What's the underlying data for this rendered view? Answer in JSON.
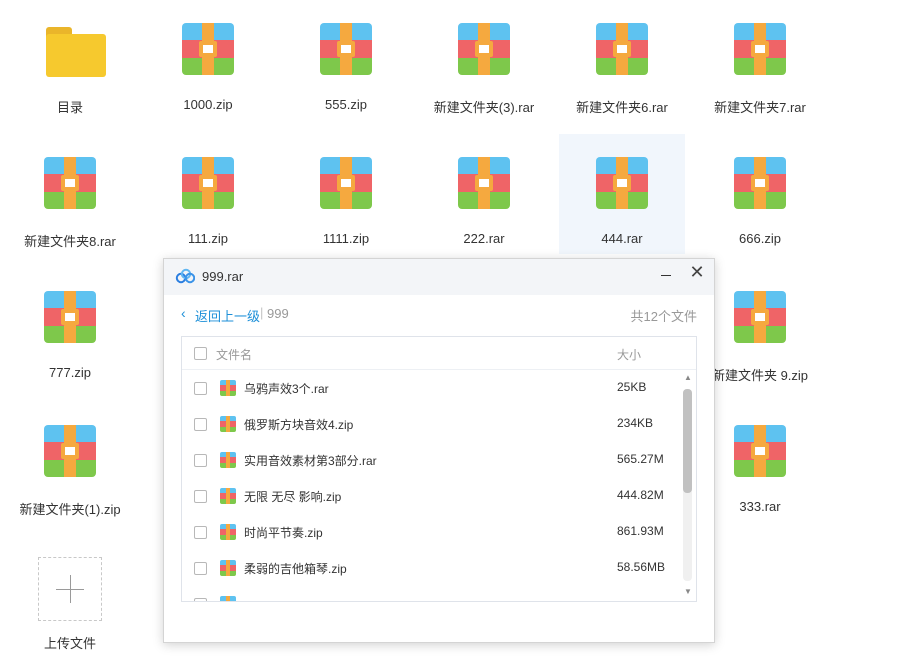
{
  "colors": {
    "archive_blue": "#5ec2f0",
    "archive_red": "#ef6467",
    "archive_green": "#7ec84b",
    "archive_strap": "#f5a93f",
    "folder_yellow": "#f6c92e",
    "folder_tab": "#eab52a",
    "link_blue": "#1c8fd8",
    "highlight": "#f1f6fc"
  },
  "grid": {
    "items": [
      {
        "label": "目录",
        "icon": "folder-icon",
        "kind": "folder"
      },
      {
        "label": "1000.zip",
        "icon": "archive-icon",
        "kind": "archive"
      },
      {
        "label": "555.zip",
        "icon": "archive-icon",
        "kind": "archive"
      },
      {
        "label": "新建文件夹(3).rar",
        "icon": "archive-icon",
        "kind": "archive"
      },
      {
        "label": "新建文件夹6.rar",
        "icon": "archive-icon",
        "kind": "archive"
      },
      {
        "label": "新建文件夹7.rar",
        "icon": "archive-icon",
        "kind": "archive"
      },
      {
        "label": "新建文件夹8.rar",
        "icon": "archive-icon",
        "kind": "archive"
      },
      {
        "label": "111.zip",
        "icon": "archive-icon",
        "kind": "archive"
      },
      {
        "label": "1111.zip",
        "icon": "archive-icon",
        "kind": "archive"
      },
      {
        "label": "222.rar",
        "icon": "archive-icon",
        "kind": "archive"
      },
      {
        "label": "444.rar",
        "icon": "archive-icon",
        "kind": "archive",
        "selected": true
      },
      {
        "label": "666.zip",
        "icon": "archive-icon",
        "kind": "archive"
      },
      {
        "label": "777.zip",
        "icon": "archive-icon",
        "kind": "archive"
      },
      {
        "label": "新建文件夹 9.zip",
        "icon": "archive-icon",
        "kind": "archive"
      },
      {
        "label": "新建文件夹(1).zip",
        "icon": "archive-icon",
        "kind": "archive"
      },
      {
        "label": "333.rar",
        "icon": "archive-icon",
        "kind": "archive"
      }
    ],
    "upload_label": "上传文件",
    "upload_icon": "plus-icon"
  },
  "dialog": {
    "title": "999.rar",
    "app_icon": "cloud-logo-icon",
    "minimize_icon": "minimize-icon",
    "close_glyph": "✕",
    "back_label": "返回上一级",
    "separator": "|",
    "breadcrumb": "999",
    "count_text": "共12个文件",
    "header_name": "文件名",
    "header_size": "大小",
    "files": [
      {
        "name": "乌鸦声效3个.rar",
        "size": "25KB"
      },
      {
        "name": "俄罗斯方块音效4.zip",
        "size": "234KB"
      },
      {
        "name": "实用音效素材第3部分.rar",
        "size": "565.27M"
      },
      {
        "name": "无限 无尽 影响.zip",
        "size": "444.82M"
      },
      {
        "name": "时尚平节奏.zip",
        "size": "861.93M"
      },
      {
        "name": "柔弱的吉他箱琴.zip",
        "size": "58.56MB"
      }
    ]
  }
}
